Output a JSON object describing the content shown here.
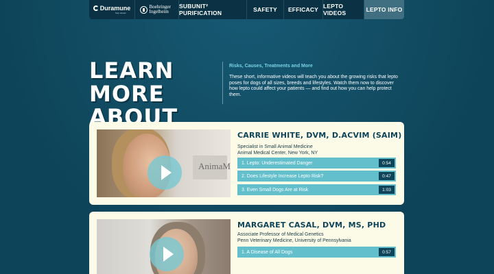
{
  "nav": {
    "brand1": {
      "main": "Duramune",
      "sub": "Step ahead."
    },
    "brand2": "Boehringer Ingelheim",
    "items": [
      {
        "label": "SUBUNIT² PURIFICATION"
      },
      {
        "label": "SAFETY"
      },
      {
        "label": "EFFICACY"
      },
      {
        "label": "LEPTO VIDEOS"
      },
      {
        "label": "LEPTO INFO"
      }
    ]
  },
  "hero": {
    "title_line1": "LEARN MORE",
    "title_line2": "ABOUT LEPTO",
    "subtitle": "Risks, Causes, Treatments and More",
    "body": "These short, informative videos will teach you about the growing risks that lepto poses for dogs of all sizes, breeds and lifestyles. Watch them now to discover how lepto could affect your patients — and find out how you can help protect them."
  },
  "doctors": [
    {
      "name": "CARRIE WHITE, DVM, D.ACVIM (SAIM)",
      "line1": "Specialist in Small Animal Medicine",
      "line2": "Animal Medical Center, New York, NY",
      "thumb_sign": "AnimaMe",
      "videos": [
        {
          "title": "1. Lepto: Underestimated Danger",
          "duration": "0:54"
        },
        {
          "title": "2. Does Lifestyle Increase Lepto Risk?",
          "duration": "0:47"
        },
        {
          "title": "3. Even Small Dogs Are at Risk",
          "duration": "1:03"
        }
      ]
    },
    {
      "name": "MARGARET CASAL, DVM, MS, PHD",
      "line1": "Associate Professor of Medical Genetics",
      "line2": "Penn Veterinary Medicine, University of Pennsylvania",
      "videos": [
        {
          "title": "1. A Disease of All Dogs",
          "duration": "0:57"
        }
      ]
    }
  ],
  "colors": {
    "background": "#0f4860",
    "accent": "#63bfcb",
    "card": "#fbfbe8",
    "subtitle": "#7ad3e6"
  }
}
